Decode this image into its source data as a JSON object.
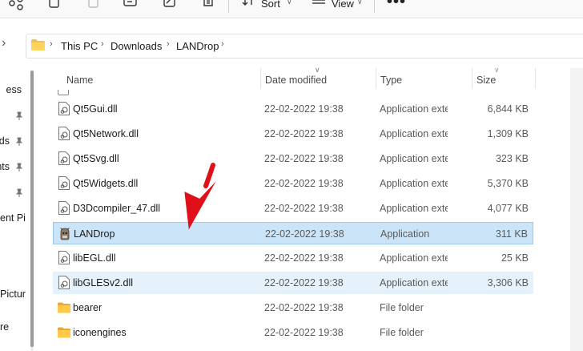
{
  "toolbar": {
    "sort_label": "Sort",
    "view_label": "View",
    "more_label": "•••"
  },
  "address": {
    "crumbs": [
      "This PC",
      "Downloads",
      "LANDrop"
    ]
  },
  "sidebar": {
    "items": [
      "ess",
      "ds",
      "nts",
      "ent Pi",
      "Pictur",
      "re"
    ]
  },
  "columns": {
    "name": "Name",
    "date": "Date modified",
    "type": "Type",
    "size": "Size"
  },
  "files": [
    {
      "name": "Qt5Gui.dll",
      "date": "22-02-2022 19:38",
      "type": "Application exten...",
      "size": "6,844 KB",
      "icon": "dll-file-icon"
    },
    {
      "name": "Qt5Network.dll",
      "date": "22-02-2022 19:38",
      "type": "Application exten...",
      "size": "1,309 KB",
      "icon": "dll-file-icon"
    },
    {
      "name": "Qt5Svg.dll",
      "date": "22-02-2022 19:38",
      "type": "Application exten...",
      "size": "323 KB",
      "icon": "dll-file-icon"
    },
    {
      "name": "Qt5Widgets.dll",
      "date": "22-02-2022 19:38",
      "type": "Application exten...",
      "size": "5,370 KB",
      "icon": "dll-file-icon"
    },
    {
      "name": "D3Dcompiler_47.dll",
      "date": "22-02-2022 19:38",
      "type": "Application exten...",
      "size": "4,077 KB",
      "icon": "dll-file-icon"
    },
    {
      "name": "LANDrop",
      "date": "22-02-2022 19:38",
      "type": "Application",
      "size": "311 KB",
      "icon": "app-icon"
    },
    {
      "name": "libEGL.dll",
      "date": "22-02-2022 19:38",
      "type": "Application exten...",
      "size": "25 KB",
      "icon": "dll-file-icon"
    },
    {
      "name": "libGLESv2.dll",
      "date": "22-02-2022 19:38",
      "type": "Application exten...",
      "size": "3,306 KB",
      "icon": "dll-file-icon"
    },
    {
      "name": "bearer",
      "date": "22-02-2022 19:38",
      "type": "File folder",
      "size": "",
      "icon": "folder-icon"
    },
    {
      "name": "iconengines",
      "date": "22-02-2022 19:38",
      "type": "File folder",
      "size": "",
      "icon": "folder-icon"
    }
  ],
  "colors": {
    "selected_bg": "#cce4f7",
    "selected_border": "#99c9ef",
    "hover_bg": "#e5f1fb",
    "arrow": "#e0101a",
    "folder": "#f4c04e"
  }
}
